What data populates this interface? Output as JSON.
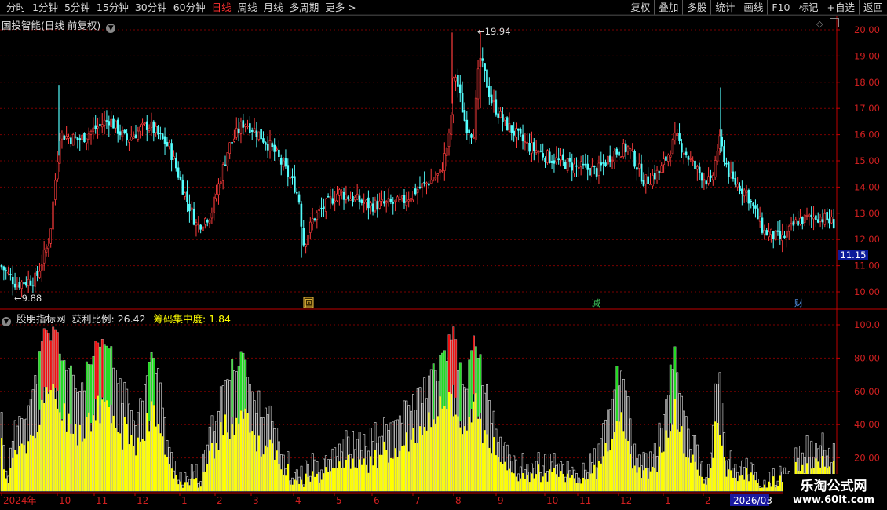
{
  "toolbar": {
    "periods": [
      "分时",
      "1分钟",
      "5分钟",
      "15分钟",
      "30分钟",
      "60分钟",
      "日线",
      "周线",
      "月线",
      "多周期",
      "更多 >"
    ],
    "active_period": "日线",
    "tools": [
      "复权",
      "叠加",
      "多股",
      "统计",
      "画线",
      "F10",
      "标记",
      "+自选",
      "返回"
    ]
  },
  "main_panel": {
    "title": "国投智能(日线 前复权)",
    "high_label": "19.94",
    "low_label": "9.88",
    "current_price": "11.15",
    "event_markers": [
      "回",
      "减",
      "财"
    ],
    "colors": {
      "up": "#ff3c3c",
      "down": "#54ffff",
      "grid": "#7a0000",
      "axis": "#c00000"
    }
  },
  "sub_panel": {
    "title": "股朋指标网",
    "indicator1_label": "获利比例:",
    "indicator1_value": "26.42",
    "indicator2_label": "筹码集中度:",
    "indicator2_value": "1.84",
    "colors": {
      "yellow": "#ffff00",
      "gray": "#c8c8c8",
      "green": "#22dd22",
      "red": "#ee1111"
    }
  },
  "price_axis": [
    "20.00",
    "19.00",
    "18.00",
    "17.00",
    "16.00",
    "15.00",
    "14.00",
    "13.00",
    "12.00",
    "11.00",
    "10.00"
  ],
  "indicator_axis": [
    "100.0",
    "80.00",
    "60.00",
    "40.00",
    "20.00"
  ],
  "date_axis": [
    "2024年",
    "10",
    "11",
    "12",
    "1",
    "2",
    "3",
    "4",
    "5",
    "6",
    "7",
    "8",
    "9",
    "10",
    "11",
    "12",
    "1",
    "2",
    "2026/03"
  ],
  "watermark": {
    "title": "乐淘公式网",
    "url": "www.60lt.com"
  }
}
